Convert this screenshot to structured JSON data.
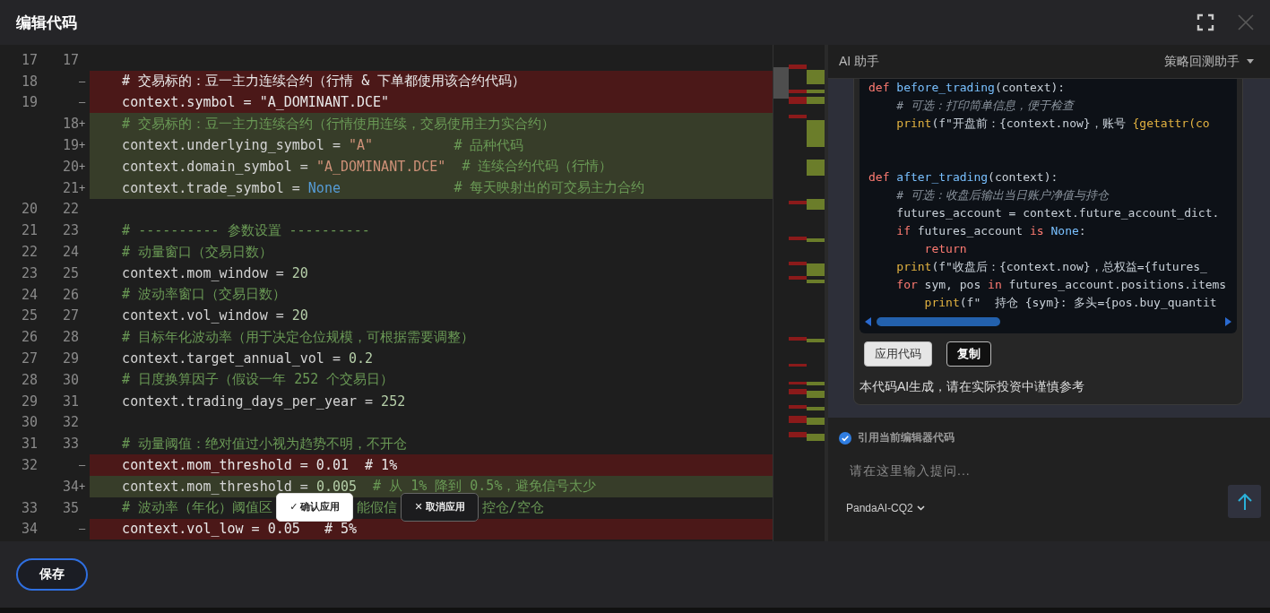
{
  "window": {
    "title": "编辑代码"
  },
  "editor": {
    "lines": [
      {
        "old": "17",
        "new": "17",
        "kind": "context"
      },
      {
        "old": "18",
        "marker": "—",
        "kind": "removed",
        "segments": [
          {
            "text": "    # 交易标的：豆一主力连续合约（行情 & 下单都使用该合约代码）",
            "kind": "comment"
          }
        ]
      },
      {
        "old": "19",
        "marker": "—",
        "kind": "removed",
        "segments": [
          {
            "text": "    context.symbol = \"A_DOMINANT.DCE\"",
            "kind": "plain"
          }
        ]
      },
      {
        "new": "18",
        "marker": "+",
        "kind": "added",
        "segments": [
          {
            "text": "    # 交易标的：豆一主力连续合约（行情使用连续，交易使用主力实合约）",
            "kind": "comment"
          }
        ]
      },
      {
        "new": "19",
        "marker": "+",
        "kind": "added",
        "segments": [
          {
            "text": "    context.underlying_symbol = ",
            "kind": "plain"
          },
          {
            "text": "\"A\"",
            "kind": "string"
          },
          {
            "text": "          # 品种代码",
            "kind": "comment"
          }
        ]
      },
      {
        "new": "20",
        "marker": "+",
        "kind": "added",
        "segments": [
          {
            "text": "    context.domain_symbol = ",
            "kind": "plain"
          },
          {
            "text": "\"A_DOMINANT.DCE\"",
            "kind": "string"
          },
          {
            "text": "  # 连续合约代码（行情）",
            "kind": "comment"
          }
        ]
      },
      {
        "new": "21",
        "marker": "+",
        "kind": "added",
        "segments": [
          {
            "text": "    context.trade_symbol = ",
            "kind": "plain"
          },
          {
            "text": "None",
            "kind": "const"
          },
          {
            "text": "              # 每天映射出的可交易主力合约",
            "kind": "comment"
          }
        ]
      },
      {
        "old": "20",
        "new": "22",
        "kind": "context"
      },
      {
        "old": "21",
        "new": "23",
        "kind": "context",
        "segments": [
          {
            "text": "    # ---------- 参数设置 ----------",
            "kind": "comment"
          }
        ]
      },
      {
        "old": "22",
        "new": "24",
        "kind": "context",
        "segments": [
          {
            "text": "    # 动量窗口（交易日数）",
            "kind": "comment"
          }
        ]
      },
      {
        "old": "23",
        "new": "25",
        "kind": "context",
        "segments": [
          {
            "text": "    context.mom_window = ",
            "kind": "plain"
          },
          {
            "text": "20",
            "kind": "number"
          }
        ]
      },
      {
        "old": "24",
        "new": "26",
        "kind": "context",
        "segments": [
          {
            "text": "    # 波动率窗口（交易日数）",
            "kind": "comment"
          }
        ]
      },
      {
        "old": "25",
        "new": "27",
        "kind": "context",
        "segments": [
          {
            "text": "    context.vol_window = ",
            "kind": "plain"
          },
          {
            "text": "20",
            "kind": "number"
          }
        ]
      },
      {
        "old": "26",
        "new": "28",
        "kind": "context",
        "segments": [
          {
            "text": "    # 目标年化波动率（用于决定仓位规模，可根据需要调整）",
            "kind": "comment"
          }
        ]
      },
      {
        "old": "27",
        "new": "29",
        "kind": "context",
        "segments": [
          {
            "text": "    context.target_annual_vol = ",
            "kind": "plain"
          },
          {
            "text": "0.2",
            "kind": "number"
          }
        ]
      },
      {
        "old": "28",
        "new": "30",
        "kind": "context",
        "segments": [
          {
            "text": "    # 日度换算因子（假设一年 252 个交易日）",
            "kind": "comment"
          }
        ]
      },
      {
        "old": "29",
        "new": "31",
        "kind": "context",
        "segments": [
          {
            "text": "    context.trading_days_per_year = ",
            "kind": "plain"
          },
          {
            "text": "252",
            "kind": "number"
          }
        ]
      },
      {
        "old": "30",
        "new": "32",
        "kind": "context"
      },
      {
        "old": "31",
        "new": "33",
        "kind": "context",
        "segments": [
          {
            "text": "    # 动量阈值：绝对值过小视为趋势不明，不开仓",
            "kind": "comment"
          }
        ]
      },
      {
        "old": "32",
        "marker": "—",
        "kind": "removed",
        "segments": [
          {
            "text": "    context.mom_threshold = 0.01  # 1%",
            "kind": "plain"
          }
        ]
      },
      {
        "new": "34",
        "marker": "+",
        "kind": "added",
        "segments": [
          {
            "text": "    context.mom_threshold = ",
            "kind": "plain"
          },
          {
            "text": "0.005",
            "kind": "number"
          },
          {
            "text": "  # 从 1% 降到 0.5%，避免信号太少",
            "kind": "comment"
          }
        ]
      },
      {
        "old": "33",
        "new": "35",
        "kind": "context",
        "segments": [
          {
            "text": "    # 波动率（年化）阈值区",
            "kind": "comment"
          },
          {
            "kind": "confirm",
            "icon": "✓",
            "label": "确认应用"
          },
          {
            "text": "能假信",
            "kind": "comment"
          },
          {
            "kind": "cancel",
            "icon": "✕",
            "label": "取消应用"
          },
          {
            "text": "控仓/空仓",
            "kind": "comment"
          }
        ]
      },
      {
        "old": "34",
        "marker": "—",
        "kind": "removed",
        "segments": [
          {
            "text": "    context.vol_low = 0.05   # 5%",
            "kind": "plain"
          }
        ]
      }
    ]
  },
  "assistant": {
    "title": "AI 助手",
    "mode": "策略回测助手",
    "code": [
      {
        "kind": "code",
        "segments": [
          {
            "text": "def ",
            "kind": "kw"
          },
          {
            "text": "before_trading",
            "kind": "fn"
          },
          {
            "text": "(context):",
            "kind": "plain"
          }
        ]
      },
      {
        "kind": "code",
        "segments": [
          {
            "text": "    # 可选：打印简单信息，便于检查",
            "kind": "comment"
          }
        ]
      },
      {
        "kind": "code",
        "segments": [
          {
            "text": "    print",
            "kind": "builtin"
          },
          {
            "text": "(f\"开盘前：{context.now}，账号 ",
            "kind": "plain"
          },
          {
            "text": "{getattr(co",
            "kind": "builtin"
          }
        ]
      },
      {
        "kind": "blank"
      },
      {
        "kind": "blank"
      },
      {
        "kind": "code",
        "segments": [
          {
            "text": "def ",
            "kind": "kw"
          },
          {
            "text": "after_trading",
            "kind": "fn"
          },
          {
            "text": "(context):",
            "kind": "plain"
          }
        ]
      },
      {
        "kind": "code",
        "segments": [
          {
            "text": "    # 可选：收盘后输出当日账户净值与持仓",
            "kind": "comment"
          }
        ]
      },
      {
        "kind": "code",
        "segments": [
          {
            "text": "    futures_account = context.future_account_dict.",
            "kind": "plain"
          }
        ]
      },
      {
        "kind": "code",
        "segments": [
          {
            "text": "    if",
            "kind": "kw"
          },
          {
            "text": " futures_account ",
            "kind": "plain"
          },
          {
            "text": "is",
            "kind": "kw"
          },
          {
            "text": " None",
            "kind": "const"
          },
          {
            "text": ":",
            "kind": "plain"
          }
        ]
      },
      {
        "kind": "code",
        "segments": [
          {
            "text": "        return",
            "kind": "kw"
          }
        ]
      },
      {
        "kind": "code",
        "segments": [
          {
            "text": "    print",
            "kind": "builtin"
          },
          {
            "text": "(f\"收盘后：{context.now}，总权益={futures_",
            "kind": "plain"
          }
        ]
      },
      {
        "kind": "code",
        "segments": [
          {
            "text": "    for",
            "kind": "kw"
          },
          {
            "text": " sym, pos ",
            "kind": "plain"
          },
          {
            "text": "in",
            "kind": "kw"
          },
          {
            "text": " futures_account.positions.items",
            "kind": "plain"
          }
        ]
      },
      {
        "kind": "code",
        "segments": [
          {
            "text": "        print",
            "kind": "builtin"
          },
          {
            "text": "(f\"  持仓 {sym}: 多头={pos.buy_quantit",
            "kind": "plain"
          }
        ]
      }
    ],
    "actions": [
      {
        "label": "应用代码",
        "kind": "light"
      },
      {
        "label": "复制",
        "kind": "dark"
      }
    ],
    "disclaimer": "本代码AI生成，请在实际投资中谨慎参考",
    "quote_editor": {
      "label": "引用当前编辑器代码",
      "checked": true
    },
    "input": {
      "placeholder": "请在这里输入提问..."
    },
    "model": "PandaAI-CQ2"
  },
  "footer": {
    "save": "保存"
  }
}
